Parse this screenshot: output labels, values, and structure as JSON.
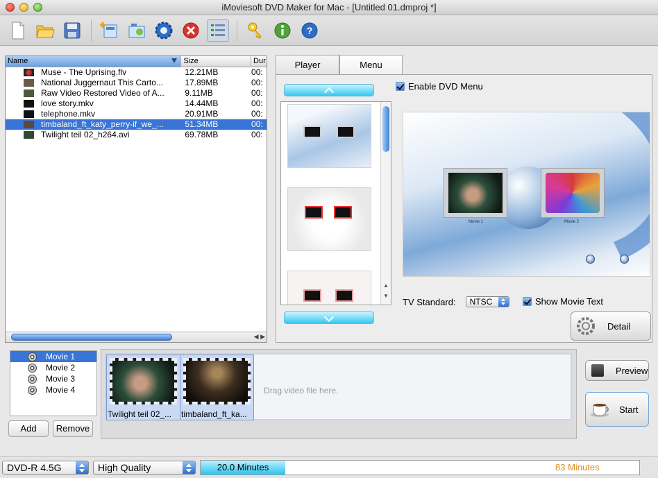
{
  "window": {
    "title": "iMoviesoft DVD Maker for Mac - [Untitled 01.dmproj *]"
  },
  "toolbar": {
    "icons": [
      "new-icon",
      "open-folder-icon",
      "save-icon",
      "add-files-icon",
      "add-folder-icon",
      "settings-gear-icon",
      "delete-icon",
      "list-view-icon",
      "key-icon",
      "info-icon",
      "help-icon"
    ]
  },
  "file_list": {
    "columns": [
      "Name",
      "Size",
      "Dur"
    ],
    "rows": [
      {
        "name": "Muse - The Uprising.flv",
        "size": "12.21MB",
        "dur": "00:"
      },
      {
        "name": "National Juggernaut  This Carto...",
        "size": "17.89MB",
        "dur": "00:"
      },
      {
        "name": "Raw Video  Restored Video of A...",
        "size": "9.11MB",
        "dur": "00:"
      },
      {
        "name": "love story.mkv",
        "size": "14.44MB",
        "dur": "00:"
      },
      {
        "name": "telephone.mkv",
        "size": "20.91MB",
        "dur": "00:"
      },
      {
        "name": "timbaland_ft_katy_perry-if_we_...",
        "size": "51.34MB",
        "dur": "00:",
        "selected": true
      },
      {
        "name": "Twilight teil 02_h264.avi",
        "size": "69.78MB",
        "dur": "00:"
      }
    ]
  },
  "tabs": {
    "player": "Player",
    "menu": "Menu"
  },
  "menu_panel": {
    "enable_label": "Enable DVD Menu",
    "tv_standard_label": "TV Standard:",
    "tv_standard_value": "NTSC",
    "show_text_label": "Show Movie Text",
    "detail_label": "Detail",
    "preview_captions": [
      "Movie 1",
      "Movie 2"
    ]
  },
  "movies": {
    "items": [
      "Movie 1",
      "Movie 2",
      "Movie 3",
      "Movie 4"
    ],
    "add_label": "Add",
    "remove_label": "Remove"
  },
  "timeline": {
    "clips": [
      "Twilight teil 02_...",
      "timbaland_ft_ka..."
    ],
    "drag_hint": "Drag video file here."
  },
  "actions": {
    "preview_label": "Preview",
    "start_label": "Start"
  },
  "status": {
    "disc_type": "DVD-R 4.5G",
    "quality": "High Quality",
    "used": "20.0 Minutes",
    "capacity": "83 Minutes",
    "used_fraction": 0.2,
    "fill_fraction": 0.193
  },
  "colors": {
    "selection": "#3875d7",
    "accent_cyan": "#2cc3ee",
    "capacity_text": "#e08a1e"
  }
}
